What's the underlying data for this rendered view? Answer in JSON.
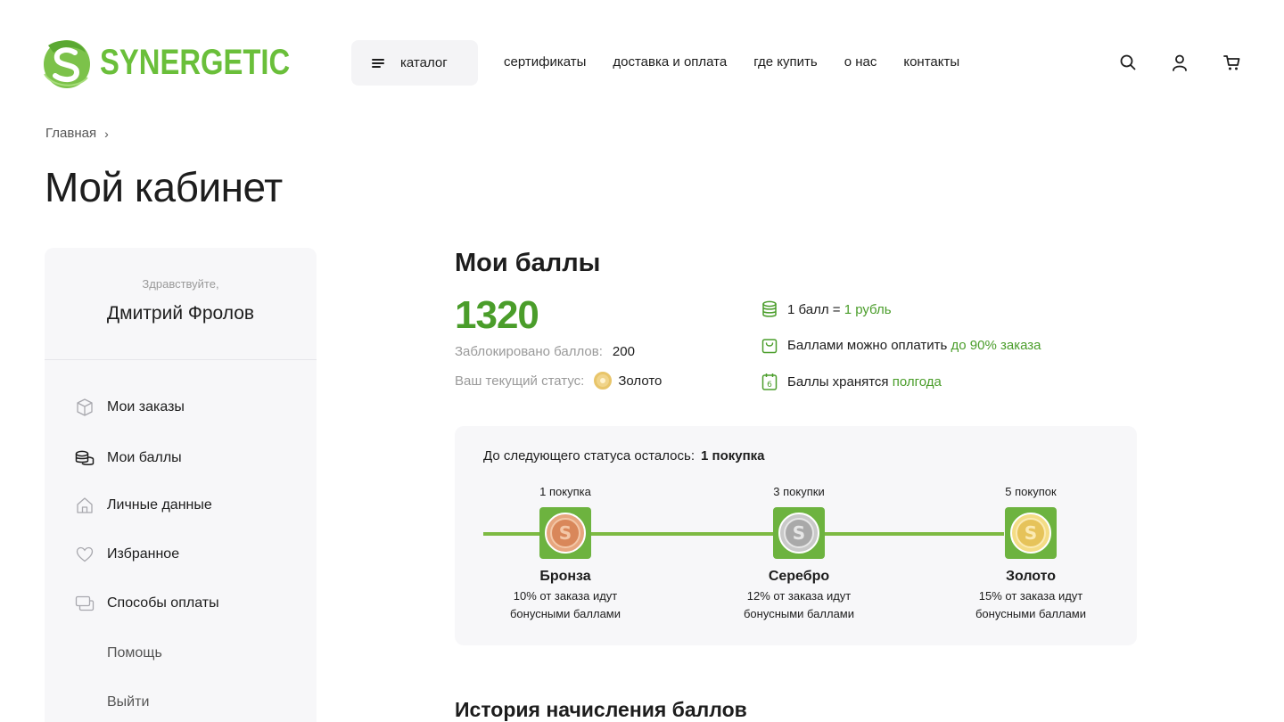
{
  "brand": {
    "name": "SYNERGETIC",
    "color": "#6abf3a",
    "icon": "leaf-s-logo"
  },
  "header": {
    "catalog_label": "каталог",
    "nav": [
      "сертификаты",
      "доставка и оплата",
      "где купить",
      "о нас",
      "контакты"
    ],
    "icons": [
      "search-icon",
      "user-icon",
      "cart-icon"
    ]
  },
  "breadcrumb": {
    "home": "Главная",
    "separator": "›"
  },
  "page_title": "Мой кабинет",
  "sidebar": {
    "greeting": "Здравствуйте,",
    "user_name": "Дмитрий Фролов",
    "menu": [
      {
        "label": "Мои заказы",
        "icon": "box-icon"
      },
      {
        "label": "Мои баллы",
        "icon": "coins-icon"
      },
      {
        "label": "Личные данные",
        "icon": "home-icon"
      },
      {
        "label": "Избранное",
        "icon": "heart-icon"
      },
      {
        "label": "Способы оплаты",
        "icon": "cards-icon"
      },
      {
        "label": "Помощь",
        "icon": ""
      },
      {
        "label": "Выйти",
        "icon": ""
      }
    ]
  },
  "points": {
    "title": "Мои баллы",
    "balance": "1320",
    "blocked_label": "Заблокировано баллов:",
    "blocked_value": "200",
    "status_label": "Ваш текущий статус:",
    "status_value": "Золото",
    "accent_color": "#4a9d2a"
  },
  "facts": [
    {
      "icon": "coins-icon",
      "text": "1 балл = ",
      "highlight": "1 рубль"
    },
    {
      "icon": "bag-icon",
      "text": "Баллами можно оплатить ",
      "highlight": "до 90% заказа"
    },
    {
      "icon": "calendar-icon",
      "text": "Баллы хранятся ",
      "highlight": "полгода"
    }
  ],
  "status_progress": {
    "label": "До следующего статуса осталось:",
    "remaining": "1 покупка",
    "levels": [
      {
        "count": "1 покупка",
        "name": "Бронза",
        "desc1": "10% от заказа идут",
        "desc2": "бонусными баллами",
        "medal": "bronze-medal-icon"
      },
      {
        "count": "3 покупки",
        "name": "Серебро",
        "desc1": "12% от заказа идут",
        "desc2": "бонусными баллами",
        "medal": "silver-medal-icon"
      },
      {
        "count": "5 покупок",
        "name": "Золото",
        "desc1": "15% от заказа идут",
        "desc2": "бонусными баллами",
        "medal": "gold-medal-icon"
      }
    ]
  },
  "history_title": "История начисления баллов"
}
